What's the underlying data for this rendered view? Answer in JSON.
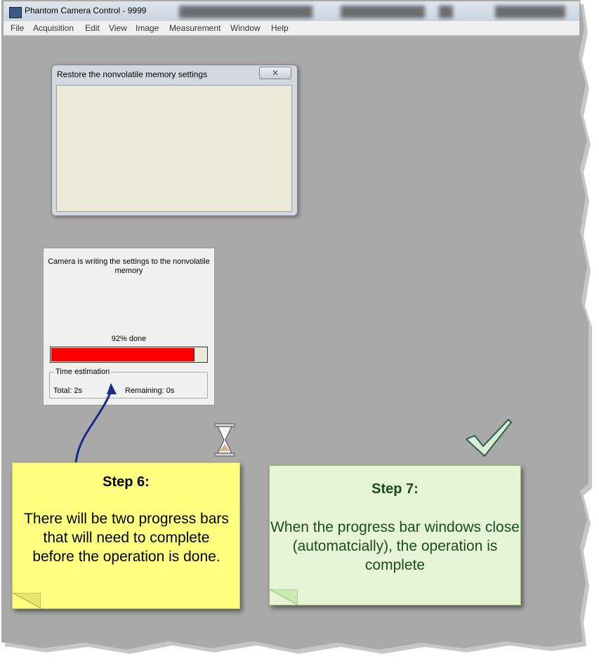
{
  "window": {
    "title": "Phantom Camera Control  -  9999"
  },
  "menu": [
    "File",
    "Acquisition",
    "Edit",
    "View",
    "Image",
    "Measurement",
    "Window",
    "Help"
  ],
  "restore_dialog": {
    "title": "Restore the nonvolatile memory settings",
    "close_label": "✕"
  },
  "progress_dialog": {
    "message": "Camera is writing the settings to the nonvolatile memory",
    "percent_text": "92%  done",
    "progress": 0.92,
    "group_label": "Time estimation",
    "total": "Total: 2s",
    "remaining": "Remaining: 0s",
    "fill_color": "#ff0000"
  },
  "note_step6": {
    "heading": "Step 6:",
    "body": "There will be two progress bars that will need to complete before the operation is done.",
    "color": "#ffff80"
  },
  "note_step7": {
    "heading": "Step 7:",
    "body": "When the progress bar windows close (automatcially), the operation is complete",
    "color": "#e6f5d5",
    "text_color": "#1a4d1a"
  },
  "icons": [
    "app-icon",
    "close-icon",
    "hourglass-icon",
    "checkmark-icon",
    "arrow-pointer"
  ]
}
